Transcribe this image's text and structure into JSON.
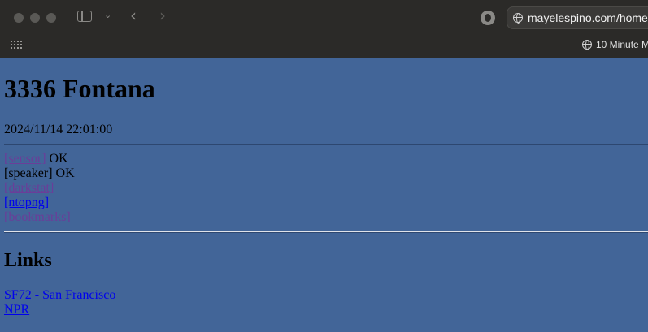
{
  "browser": {
    "url": "mayelespino.com/home",
    "bookmark": "10 Minute M"
  },
  "page": {
    "title": "3336 Fontana",
    "datetime": "2024/11/14 22:01:00",
    "status": [
      {
        "label": "[sensor]",
        "linked": true,
        "visited": true,
        "value": "OK"
      },
      {
        "label": "[speaker]",
        "linked": false,
        "value": "OK"
      },
      {
        "label": "[darkstat]",
        "linked": true,
        "visited": true,
        "value": ""
      },
      {
        "label": "[ntopng]",
        "linked": true,
        "visited": false,
        "value": ""
      },
      {
        "label": "[bookmarks]",
        "linked": true,
        "visited": true,
        "value": ""
      }
    ],
    "links_heading": "Links",
    "links": [
      "SF72 - San Francisco",
      "NPR"
    ]
  },
  "colors": {
    "page_bg": "#426598",
    "chrome_bg": "#2b2a28",
    "visited_link": "#6a3e99",
    "link": "#0000ee"
  }
}
